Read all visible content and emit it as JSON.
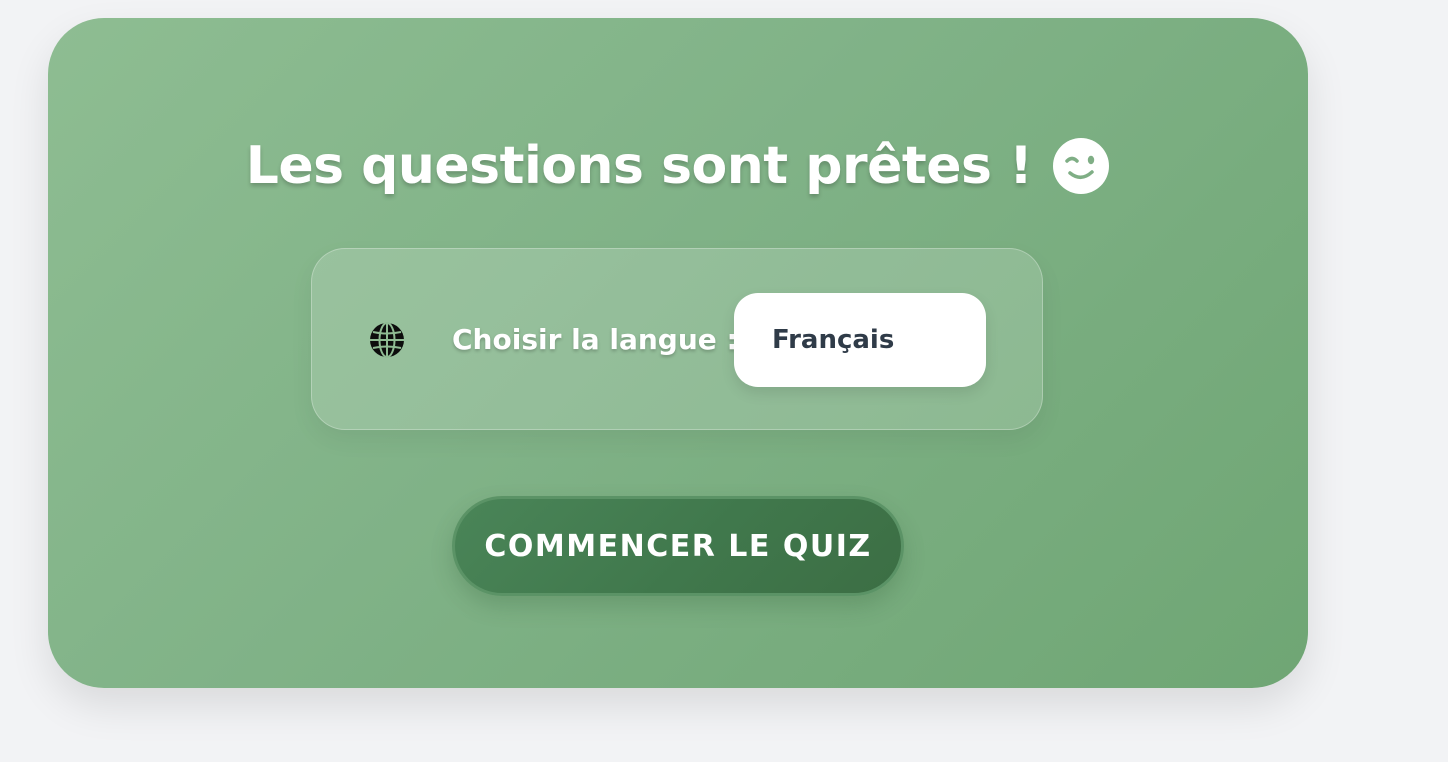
{
  "quiz_card": {
    "title": "Les questions sont prêtes !",
    "title_emoji": "winking-face-icon"
  },
  "language": {
    "icon": "globe-icon",
    "label": "Choisir la langue :",
    "selected": "Français"
  },
  "actions": {
    "start_label": "COMMENCER LE QUIZ"
  },
  "colors": {
    "page_background": "#f2f3f5",
    "card_green": "#80b287",
    "button_green": "#437b4f",
    "select_text": "#2f3b48"
  }
}
